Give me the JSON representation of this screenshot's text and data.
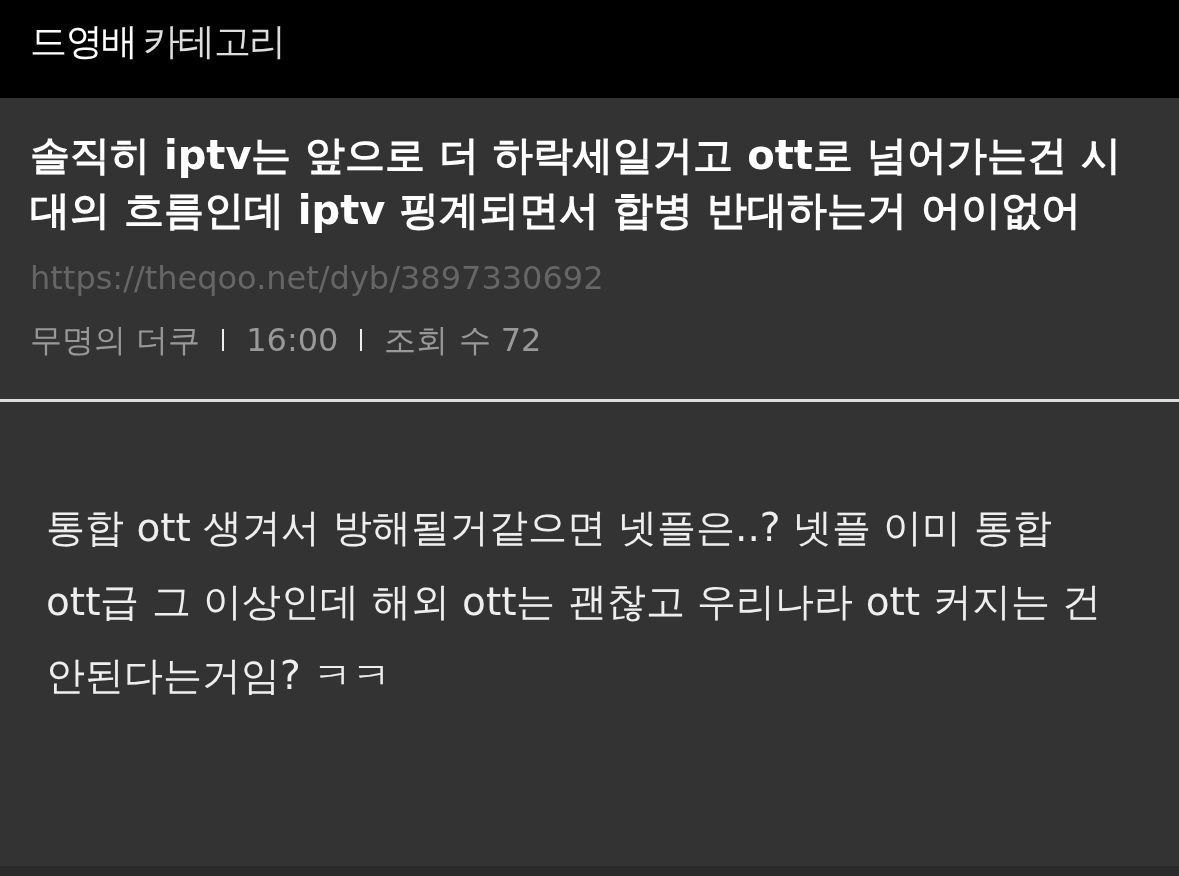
{
  "header": {
    "board": "드영배",
    "category": "카테고리"
  },
  "post": {
    "title": "솔직히 iptv는 앞으로 더 하락세일거고 ott로 넘어가는건 시대의 흐름인데 iptv 핑계되면서 합병 반대하는거 어이없어",
    "url": "https://theqoo.net/dyb/3897330692",
    "meta": {
      "author": "무명의 더쿠",
      "time": "16:00",
      "views": "조회 수 72"
    },
    "body": "통합 ott 생겨서 방해될거같으면 넷플은..? 넷플 이미 통합 ott급 그 이상인데 해외 ott는 괜찮고 우리나라 ott 커지는 건 안된다는거임? ㅋㅋ"
  }
}
